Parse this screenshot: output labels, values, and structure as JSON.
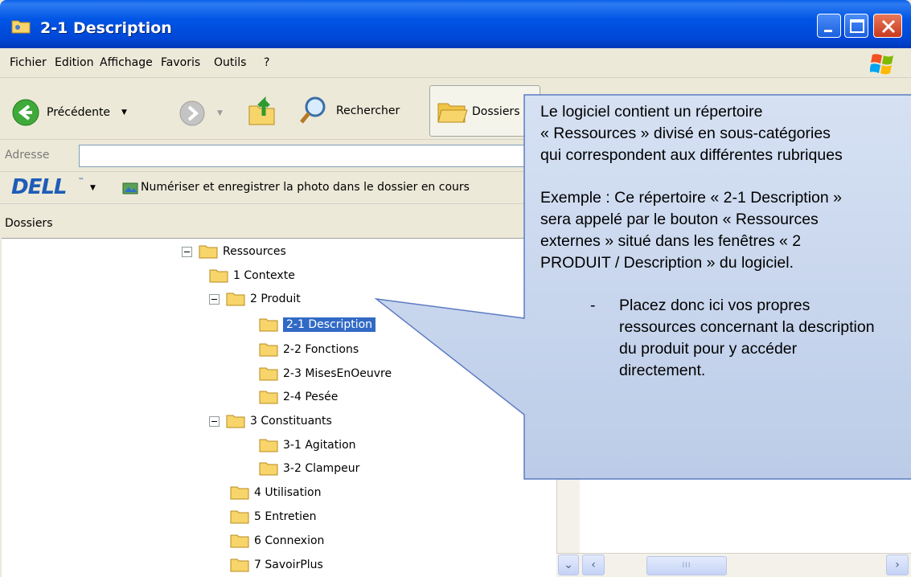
{
  "window": {
    "title": "2-1 Description"
  },
  "menu": {
    "items": [
      {
        "label": "Fichier"
      },
      {
        "label": "Edition"
      },
      {
        "label": "Affichage"
      },
      {
        "label": "Favoris"
      },
      {
        "label": "Outils"
      },
      {
        "label": "?"
      }
    ]
  },
  "toolbar": {
    "back_label": "Précédente",
    "search_label": "Rechercher",
    "folders_label": "Dossiers"
  },
  "address": {
    "label": "Adresse",
    "value": ""
  },
  "dellbar": {
    "logo": "DELL",
    "tm": "™",
    "scan_label": "Numériser et enregistrer la photo dans le dossier en cours"
  },
  "folders_pane": {
    "title": "Dossiers"
  },
  "tree": {
    "items": [
      {
        "label": "Ressources",
        "expanded": true
      },
      {
        "label": "1 Contexte"
      },
      {
        "label": "2 Produit",
        "expanded": true
      },
      {
        "label": "2-1 Description",
        "selected": true
      },
      {
        "label": "2-2 Fonctions"
      },
      {
        "label": "2-3 MisesEnOeuvre"
      },
      {
        "label": "2-4 Pesée"
      },
      {
        "label": "3 Constituants",
        "expanded": true
      },
      {
        "label": "3-1 Agitation"
      },
      {
        "label": "3-2 Clampeur"
      },
      {
        "label": "4 Utilisation"
      },
      {
        "label": "5 Entretien"
      },
      {
        "label": "6 Connexion"
      },
      {
        "label": "7 SavoirPlus"
      }
    ]
  },
  "callout": {
    "para1_lines": [
      "Le logiciel contient un répertoire",
      "« Ressources » divisé en sous-catégories",
      "qui correspondent aux différentes rubriques"
    ],
    "para2_lines": [
      "Exemple : Ce répertoire « 2-1 Description »",
      "sera appelé par le bouton « Ressources",
      "externes » situé dans les fenêtres « 2",
      "PRODUIT / Description » du logiciel."
    ],
    "bullet_dash": "-",
    "bullet_lines": [
      "Placez donc ici vos propres",
      "ressources concernant la description",
      "du produit pour y accéder",
      "directement."
    ]
  },
  "colors": {
    "titlebar": "#0054E3",
    "selection": "#316AC5",
    "callout_fill": "#C9D7EE",
    "callout_border": "#5C7BC2"
  }
}
